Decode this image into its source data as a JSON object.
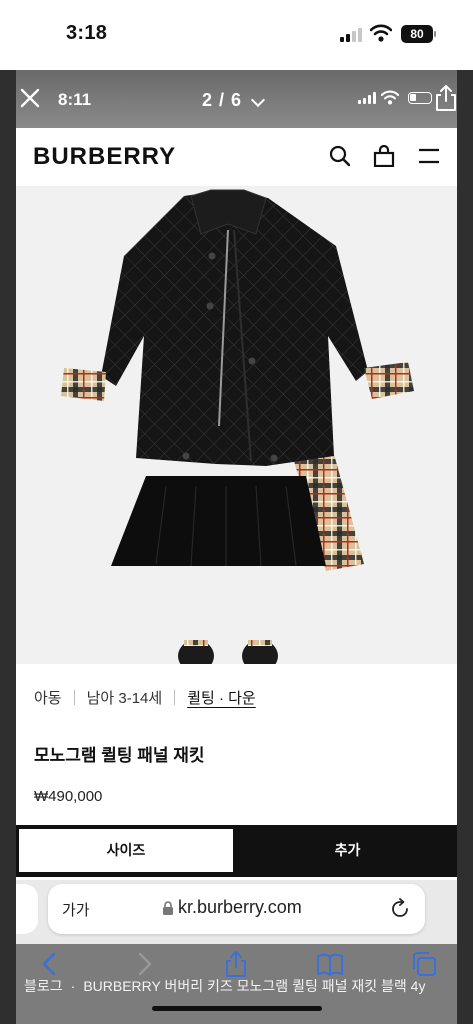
{
  "status": {
    "time": "3:18",
    "battery": "80"
  },
  "viewer": {
    "time": "8:11",
    "counter": "2 / 6"
  },
  "site": {
    "brand": "BURBERRY",
    "breadcrumbs": [
      "아동",
      "남아 3-14세",
      "퀼팅 · 다운"
    ],
    "product_title": "모노그램 퀼팅 패널 재킷",
    "price": "₩490,000",
    "size_button": "사이즈",
    "add_button": "추가"
  },
  "browser": {
    "text_size": "가가",
    "domain": "kr.burberry.com"
  },
  "caption": {
    "source": "블로그",
    "title": "BURBERRY 버버리 키즈 모노그램 퀼팅 패널 재킷 블랙 4y"
  },
  "colors": {
    "accent": "#111111",
    "check_beige": "#d9c29a",
    "check_red": "#b52a22"
  }
}
